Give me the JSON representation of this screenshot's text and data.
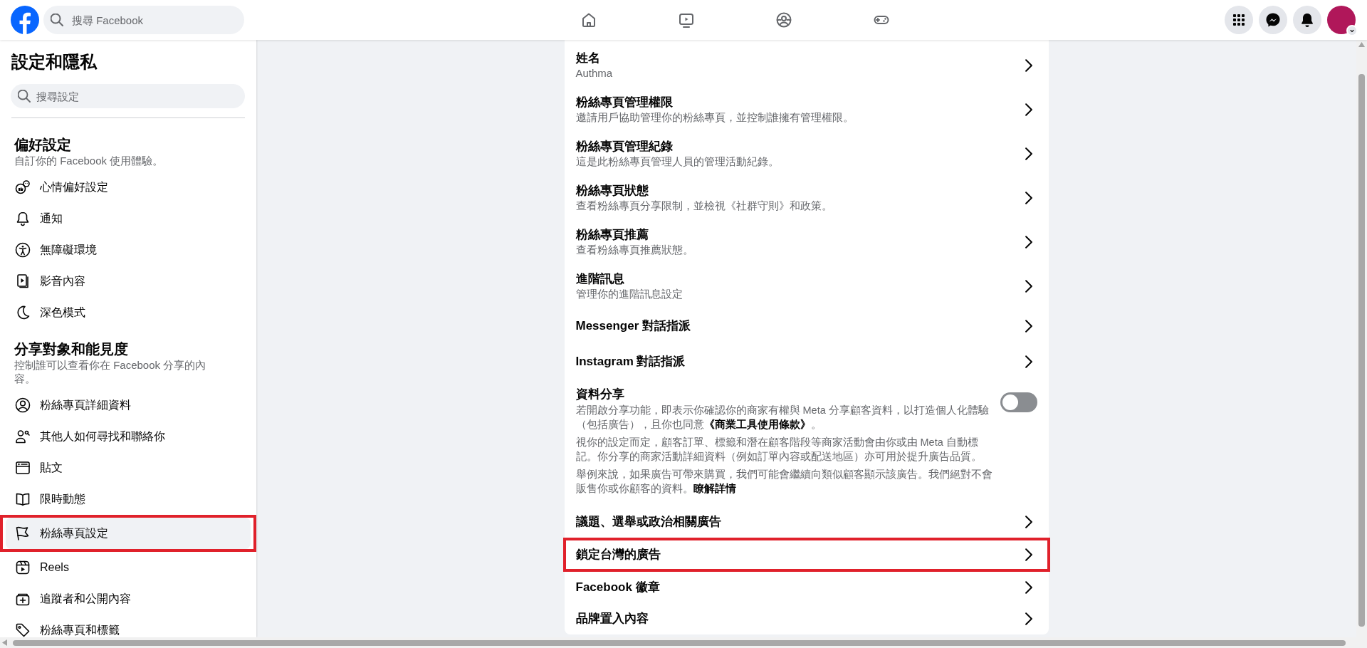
{
  "top_bar": {
    "search": {
      "placeholder": "搜尋 Facebook"
    }
  },
  "sidebar": {
    "title": "設定和隱私",
    "search": {
      "placeholder": "搜尋設定"
    },
    "sections": [
      {
        "title": "偏好設定",
        "subtitle": "自訂你的 Facebook 使用體驗。",
        "items": [
          {
            "label": "心情偏好設定",
            "selected": false,
            "highlighted": false
          },
          {
            "label": "通知",
            "selected": false,
            "highlighted": false
          },
          {
            "label": "無障礙環境",
            "selected": false,
            "highlighted": false
          },
          {
            "label": "影音內容",
            "selected": false,
            "highlighted": false
          },
          {
            "label": "深色模式",
            "selected": false,
            "highlighted": false
          }
        ]
      },
      {
        "title": "分享對象和能見度",
        "subtitle": "控制誰可以查看你在 Facebook 分享的內容。",
        "items": [
          {
            "label": "粉絲專頁詳細資料",
            "selected": false,
            "highlighted": false
          },
          {
            "label": "其他人如何尋找和聯絡你",
            "selected": false,
            "highlighted": false
          },
          {
            "label": "貼文",
            "selected": false,
            "highlighted": false
          },
          {
            "label": "限時動態",
            "selected": false,
            "highlighted": false
          },
          {
            "label": "粉絲專頁設定",
            "selected": true,
            "highlighted": true
          },
          {
            "label": "Reels",
            "selected": false,
            "highlighted": false
          },
          {
            "label": "追蹤者和公開內容",
            "selected": false,
            "highlighted": false
          },
          {
            "label": "粉絲專頁和標籤",
            "selected": false,
            "highlighted": false
          }
        ]
      }
    ]
  },
  "settings_list": {
    "rows": [
      {
        "kind": "link",
        "title": "姓名",
        "subtitle": "Authma",
        "highlighted": false
      },
      {
        "kind": "link",
        "title": "粉絲專頁管理權限",
        "subtitle": "邀請用戶協助管理你的粉絲專頁，並控制誰擁有管理權限。",
        "highlighted": false
      },
      {
        "kind": "link",
        "title": "粉絲專頁管理紀錄",
        "subtitle": "這是此粉絲專頁管理人員的管理活動紀錄。",
        "highlighted": false
      },
      {
        "kind": "link",
        "title": "粉絲專頁狀態",
        "subtitle": "查看粉絲專頁分享限制，並檢視《社群守則》和政策。",
        "highlighted": false
      },
      {
        "kind": "link",
        "title": "粉絲專頁推薦",
        "subtitle": "查看粉絲專頁推薦狀態。",
        "highlighted": false
      },
      {
        "kind": "link",
        "title": "進階訊息",
        "subtitle": "管理你的進階訊息設定",
        "highlighted": false
      },
      {
        "kind": "link",
        "title": "Messenger 對話指派",
        "highlighted": false
      },
      {
        "kind": "link",
        "title": "Instagram 對話指派",
        "highlighted": false
      },
      {
        "kind": "toggle",
        "title": "資料分享",
        "on": false,
        "paragraphs": [
          "若開啟分享功能，即表示你確認你的商家有權與 Meta 分享顧客資料，以打造個人化體驗（包括廣告），且你也同意**《商業工具使用條款》**。",
          "視你的設定而定，顧客訂單、標籤和潛在顧客階段等商家活動會由你或由 Meta 自動標記。你分享的商家活動詳細資料（例如訂單內容或配送地區）亦可用於提升廣告品質。"
        ],
        "note": "舉例來說，如果廣告可帶來購買，我們可能會繼續向類似顧客顯示該廣告。我們絕對不會販售你或你顧客的資料。",
        "link": "瞭解詳情"
      },
      {
        "kind": "link",
        "title": "議題、選舉或政治相關廣告",
        "highlighted": false
      },
      {
        "kind": "link",
        "title": "鎖定台灣的廣告",
        "highlighted": true
      },
      {
        "kind": "link",
        "title": "Facebook 徽章",
        "highlighted": false
      },
      {
        "kind": "link",
        "title": "品牌置入內容",
        "highlighted": false
      }
    ]
  }
}
